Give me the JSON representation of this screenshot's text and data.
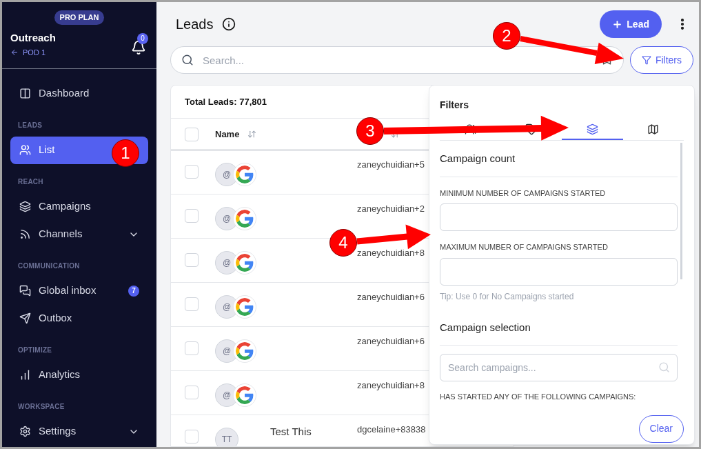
{
  "sidebar": {
    "plan_badge": "PRO PLAN",
    "workspace": "Outreach",
    "pod": "POD 1",
    "notifications": "0",
    "sections": [
      {
        "items": [
          {
            "label": "Dashboard",
            "selected": false,
            "expandable": false
          }
        ]
      },
      {
        "heading": "LEADS",
        "items": [
          {
            "label": "List",
            "selected": true,
            "expandable": false
          }
        ]
      },
      {
        "heading": "REACH",
        "items": [
          {
            "label": "Campaigns",
            "selected": false,
            "expandable": false
          },
          {
            "label": "Channels",
            "selected": false,
            "expandable": true
          }
        ]
      },
      {
        "heading": "COMMUNICATION",
        "items": [
          {
            "label": "Global inbox",
            "selected": false,
            "expandable": false,
            "badge": "7"
          },
          {
            "label": "Outbox",
            "selected": false,
            "expandable": false
          }
        ]
      },
      {
        "heading": "OPTIMIZE",
        "items": [
          {
            "label": "Analytics",
            "selected": false,
            "expandable": false
          }
        ]
      },
      {
        "heading": "WORKSPACE",
        "items": [
          {
            "label": "Settings",
            "selected": false,
            "expandable": true
          }
        ]
      }
    ]
  },
  "header": {
    "title": "Leads",
    "add_button": "Lead"
  },
  "search": {
    "placeholder": "Search..."
  },
  "filters_button": "Filters",
  "table": {
    "total": "Total Leads: 77,801",
    "columns": [
      "Name"
    ],
    "all_checked": false,
    "rows": [
      {
        "kind": "google",
        "checked": false,
        "avatar": "@",
        "email": "zaneychuidian+5"
      },
      {
        "kind": "google",
        "checked": false,
        "avatar": "@",
        "email": "zaneychuidian+2"
      },
      {
        "kind": "google",
        "checked": false,
        "avatar": "@",
        "email": "zaneychuidian+8"
      },
      {
        "kind": "google",
        "checked": false,
        "avatar": "@",
        "email": "zaneychuidian+6"
      },
      {
        "kind": "google",
        "checked": false,
        "avatar": "@",
        "email": "zaneychuidian+6"
      },
      {
        "kind": "google",
        "checked": false,
        "avatar": "@",
        "email": "zaneychuidian+8"
      },
      {
        "kind": "initials",
        "checked": false,
        "avatar": "TT",
        "name": "Test This",
        "email": "dgcelaine+83838"
      }
    ]
  },
  "filter_panel": {
    "title": "Filters",
    "tabs": [
      {
        "selected": false
      },
      {
        "selected": false
      },
      {
        "selected": true
      },
      {
        "selected": false
      }
    ],
    "count_heading": "Campaign count",
    "min_label": "MINIMUM NUMBER OF CAMPAIGNS STARTED",
    "max_label": "MAXIMUM NUMBER OF CAMPAIGNS STARTED",
    "tip": "Tip: Use 0 for No Campaigns started",
    "selection_heading": "Campaign selection",
    "campaign_search": {
      "placeholder": "Search campaigns..."
    },
    "started_label": "HAS STARTED ANY OF THE FOLLOWING CAMPAIGNS:",
    "clear_button": "Clear"
  },
  "annotations": [
    {
      "label": "1"
    },
    {
      "label": "2"
    },
    {
      "label": "3"
    },
    {
      "label": "4"
    }
  ]
}
